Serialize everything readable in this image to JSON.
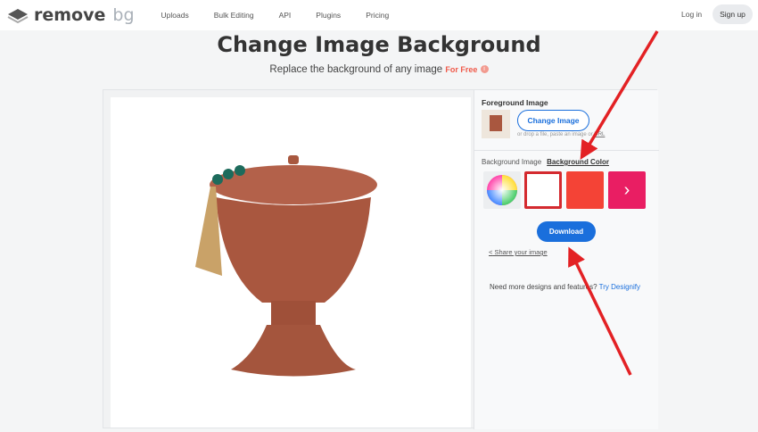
{
  "nav": {
    "logo_main": "remove",
    "logo_bg": "bg",
    "links": [
      "Uploads",
      "Bulk Editing",
      "API",
      "Plugins",
      "Pricing"
    ],
    "login": "Log in",
    "signup": "Sign up"
  },
  "hero": {
    "title": "Change Image Background",
    "subtitle": "Replace the background of any image",
    "free": "For Free",
    "info": "i"
  },
  "panel": {
    "foreground_label": "Foreground Image",
    "change_button": "Change Image",
    "drop_text": "or drop a file, paste an image or",
    "url": "URL",
    "tab_image": "Background Image",
    "tab_color": "Background Color",
    "swatches": [
      "#ffffff",
      "#f44336",
      "#e91e63"
    ],
    "next": "›",
    "download": "Download",
    "share": "Share your image",
    "need": "Need more designs and features?",
    "designify": "Try Designify"
  },
  "colors": {
    "accent": "#1a6fdc",
    "arrow": "#e32124"
  }
}
